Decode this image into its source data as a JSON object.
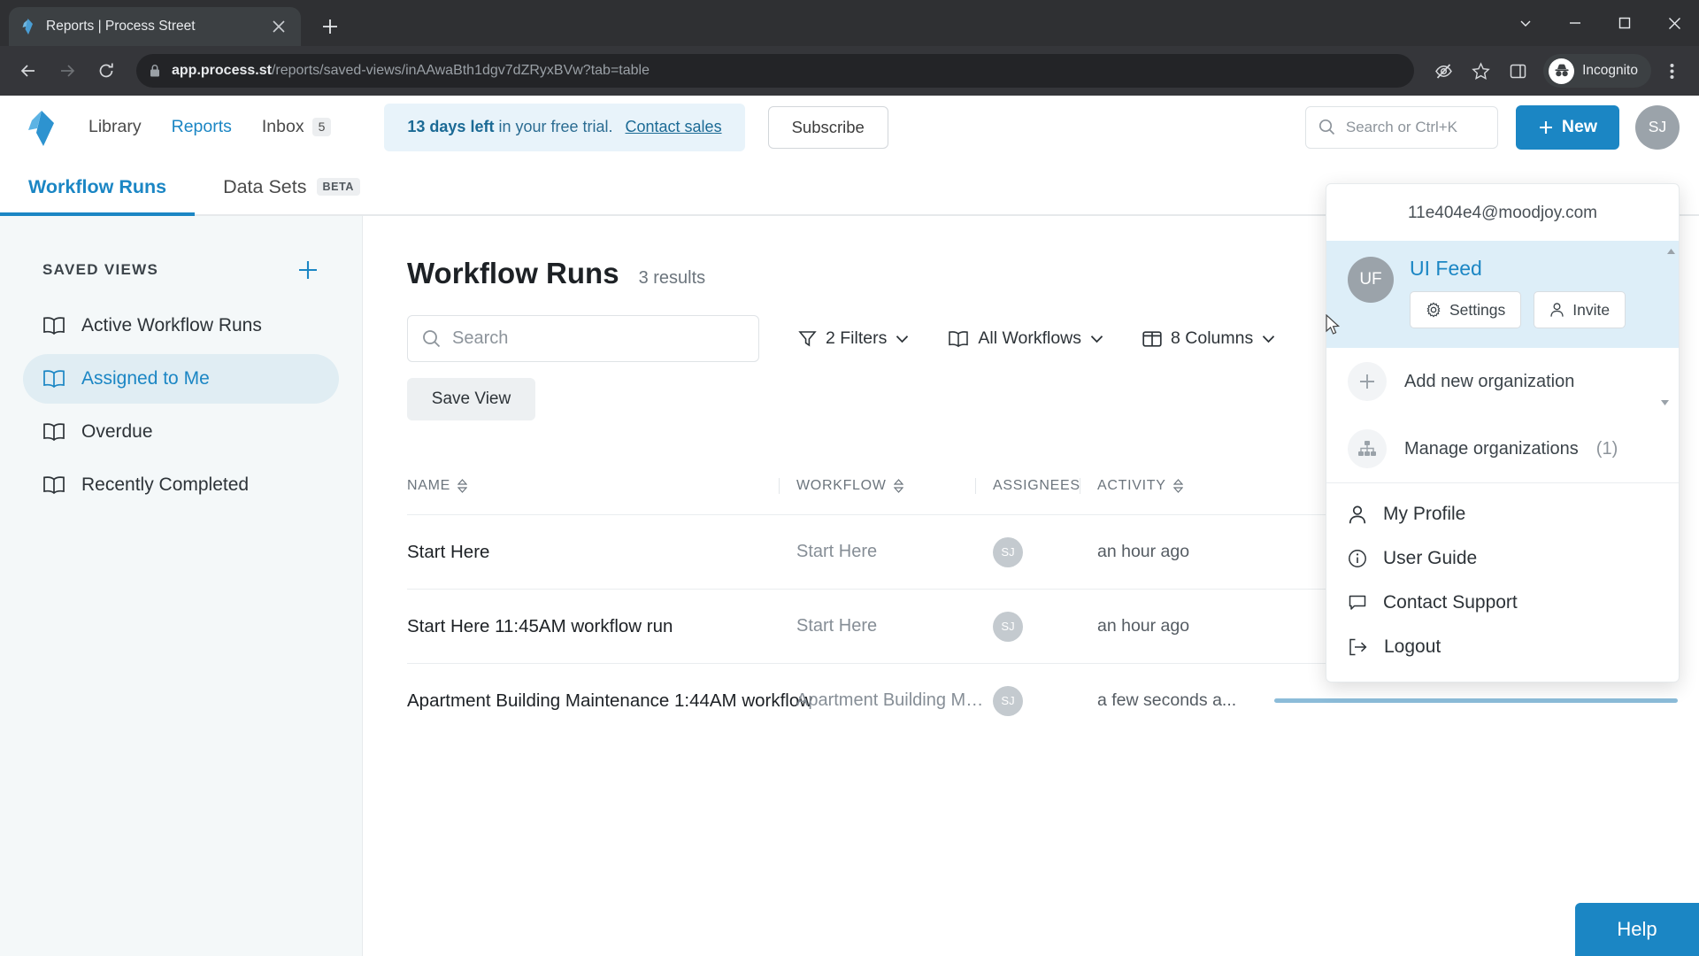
{
  "browser": {
    "tab": {
      "title": "Reports | Process Street",
      "favicon_icon": "process-street-favicon",
      "close_icon": "close-icon"
    },
    "new_tab_icon": "plus-icon",
    "window_controls": {
      "minimize_to_tray_icon": "chevron-down-icon",
      "minimize_icon": "minimize-icon",
      "maximize_icon": "maximize-icon",
      "close_icon": "close-icon"
    },
    "nav": {
      "back_icon": "back-arrow-icon",
      "forward_icon": "forward-arrow-icon",
      "reload_icon": "reload-icon"
    },
    "omnibox": {
      "lock_icon": "lock-icon",
      "url_domain": "app.process.st",
      "url_path": "/reports/saved-views/inAAwaBth1dgv7dZRyxBVw?tab=table"
    },
    "toolbar_icons": {
      "tracking_protection": "eye-slash-icon",
      "bookmark": "star-icon",
      "side_panel": "side-panel-icon",
      "menu": "three-dot-menu-icon"
    },
    "incognito": {
      "label": "Incognito",
      "icon": "incognito-hat-glasses-icon"
    }
  },
  "header": {
    "logo_icon": "process-street-logo",
    "nav": [
      {
        "label": "Library",
        "active": false
      },
      {
        "label": "Reports",
        "active": true
      }
    ],
    "inbox": {
      "label": "Inbox",
      "badge": "5"
    },
    "trial": {
      "bold": "13 days left",
      "rest": " in your free trial.",
      "link": "Contact sales"
    },
    "subscribe_label": "Subscribe",
    "search": {
      "placeholder": "Search or Ctrl+K",
      "icon": "search-icon"
    },
    "new_button": {
      "label": "New",
      "icon": "plus-icon"
    },
    "avatar": {
      "initials": "SJ"
    }
  },
  "view_tabs": [
    {
      "label": "Workflow Runs",
      "active": true,
      "badge": ""
    },
    {
      "label": "Data Sets",
      "active": false,
      "badge": "BETA"
    }
  ],
  "sidebar": {
    "section_title": "SAVED VIEWS",
    "add_icon": "plus-icon",
    "items": [
      {
        "label": "Active Workflow Runs",
        "icon": "book-icon",
        "active": false
      },
      {
        "label": "Assigned to Me",
        "icon": "book-icon",
        "active": true
      },
      {
        "label": "Overdue",
        "icon": "book-icon",
        "active": false
      },
      {
        "label": "Recently Completed",
        "icon": "book-icon",
        "active": false
      }
    ]
  },
  "main": {
    "title": "Workflow Runs",
    "results": "3 results",
    "search": {
      "placeholder": "Search",
      "icon": "search-icon"
    },
    "controls": [
      {
        "label": "2 Filters",
        "icon": "filter-icon"
      },
      {
        "label": "All Workflows",
        "icon": "book-icon"
      },
      {
        "label": "8 Columns",
        "icon": "columns-icon"
      }
    ],
    "save_view_label": "Save View",
    "table": {
      "columns": [
        {
          "label": "NAME",
          "sortable": true
        },
        {
          "label": "WORKFLOW",
          "sortable": true
        },
        {
          "label": "ASSIGNEES",
          "sortable": false
        },
        {
          "label": "ACTIVITY",
          "sortable": true
        }
      ],
      "rows": [
        {
          "name": "Start Here",
          "workflow": "Start Here",
          "assignee_initials": "SJ",
          "activity": "an hour ago",
          "progress": 0
        },
        {
          "name": "Start Here 11:45AM workflow run",
          "workflow": "Start Here",
          "assignee_initials": "SJ",
          "activity": "an hour ago",
          "progress": 0
        },
        {
          "name": "Apartment Building Maintenance 1:44AM workflow",
          "workflow": "Apartment Building Mainte",
          "assignee_initials": "SJ",
          "activity": "a few seconds a...",
          "progress": 100
        }
      ]
    },
    "help_label": "Help"
  },
  "account_dropdown": {
    "email": "11e404e4@moodjoy.com",
    "organization": {
      "initials": "UF",
      "name": "UI Feed",
      "settings_label": "Settings",
      "settings_icon": "gear-icon",
      "invite_label": "Invite",
      "invite_icon": "person-icon"
    },
    "org_actions": [
      {
        "label": "Add new organization",
        "suffix": "",
        "icon": "plus-icon"
      },
      {
        "label": "Manage organizations",
        "suffix": "(1)",
        "icon": "org-chart-icon"
      }
    ],
    "menu_items": [
      {
        "label": "My Profile",
        "icon": "person-icon"
      },
      {
        "label": "User Guide",
        "icon": "info-circle-icon"
      },
      {
        "label": "Contact Support",
        "icon": "chat-bubble-icon"
      },
      {
        "label": "Logout",
        "icon": "logout-icon"
      }
    ],
    "scroll_up_icon": "caret-up-icon",
    "scroll_down_icon": "caret-down-icon"
  },
  "colors": {
    "accent": "#1b86c4",
    "banner_bg": "#e8f3fa",
    "sidebar_bg": "#f4f8f9",
    "org_highlight": "#ddeef8",
    "progress": "#8cbcd9"
  }
}
